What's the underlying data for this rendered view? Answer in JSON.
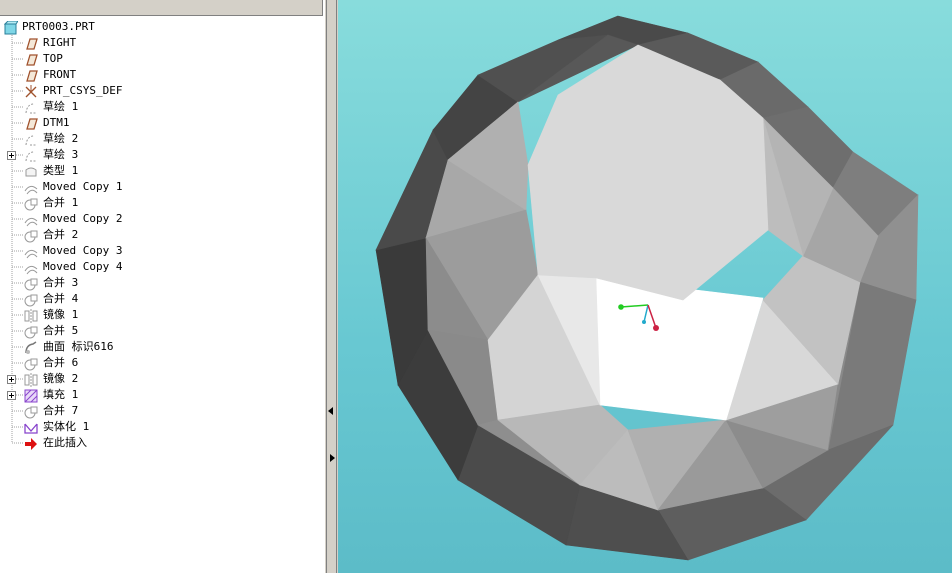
{
  "model_tree": {
    "items": [
      {
        "label": "PRT0003.PRT",
        "icon": "part-icon",
        "level": 0,
        "expander": false
      },
      {
        "label": "RIGHT",
        "icon": "datum-plane-icon",
        "level": 1,
        "expander": false
      },
      {
        "label": "TOP",
        "icon": "datum-plane-icon",
        "level": 1,
        "expander": false
      },
      {
        "label": "FRONT",
        "icon": "datum-plane-icon",
        "level": 1,
        "expander": false
      },
      {
        "label": "PRT_CSYS_DEF",
        "icon": "coordinate-system-icon",
        "level": 1,
        "expander": false
      },
      {
        "label": "草绘 1",
        "icon": "sketch-icon",
        "level": 1,
        "expander": false
      },
      {
        "label": "DTM1",
        "icon": "datum-plane-icon",
        "level": 1,
        "expander": false
      },
      {
        "label": "草绘 2",
        "icon": "sketch-icon",
        "level": 1,
        "expander": false
      },
      {
        "label": "草绘 3",
        "icon": "sketch-icon",
        "level": 1,
        "expander": true
      },
      {
        "label": "类型 1",
        "icon": "surface-type-icon",
        "level": 1,
        "expander": false
      },
      {
        "label": "Moved Copy 1",
        "icon": "moved-copy-icon",
        "level": 1,
        "expander": false
      },
      {
        "label": "合并 1",
        "icon": "merge-icon",
        "level": 1,
        "expander": false
      },
      {
        "label": "Moved Copy 2",
        "icon": "moved-copy-icon",
        "level": 1,
        "expander": false
      },
      {
        "label": "合并 2",
        "icon": "merge-icon",
        "level": 1,
        "expander": false
      },
      {
        "label": "Moved Copy 3",
        "icon": "moved-copy-icon",
        "level": 1,
        "expander": false
      },
      {
        "label": "Moved Copy 4",
        "icon": "moved-copy-icon",
        "level": 1,
        "expander": false
      },
      {
        "label": "合并 3",
        "icon": "merge-icon",
        "level": 1,
        "expander": false
      },
      {
        "label": "合并 4",
        "icon": "merge-icon",
        "level": 1,
        "expander": false
      },
      {
        "label": "镜像 1",
        "icon": "mirror-icon",
        "level": 1,
        "expander": false
      },
      {
        "label": "合并 5",
        "icon": "merge-icon",
        "level": 1,
        "expander": false
      },
      {
        "label": "曲面 标识616",
        "icon": "surface-id-icon",
        "level": 1,
        "expander": false
      },
      {
        "label": "合并 6",
        "icon": "merge-icon",
        "level": 1,
        "expander": false
      },
      {
        "label": "镜像 2",
        "icon": "mirror-icon",
        "level": 1,
        "expander": true
      },
      {
        "label": "填充 1",
        "icon": "fill-icon",
        "level": 1,
        "expander": true
      },
      {
        "label": "合并 7",
        "icon": "merge-icon",
        "level": 1,
        "expander": false
      },
      {
        "label": "实体化 1",
        "icon": "solidify-icon",
        "level": 1,
        "expander": false
      },
      {
        "label": "在此插入",
        "icon": "insert-here-arrow-icon",
        "level": 1,
        "expander": false
      }
    ]
  },
  "viewport": {
    "background_top": "#88dcdc",
    "background_bottom": "#5cbcc8",
    "axis_colors": {
      "x": "#22cc22",
      "y": "#22aacc",
      "z": "#cc2244"
    }
  }
}
